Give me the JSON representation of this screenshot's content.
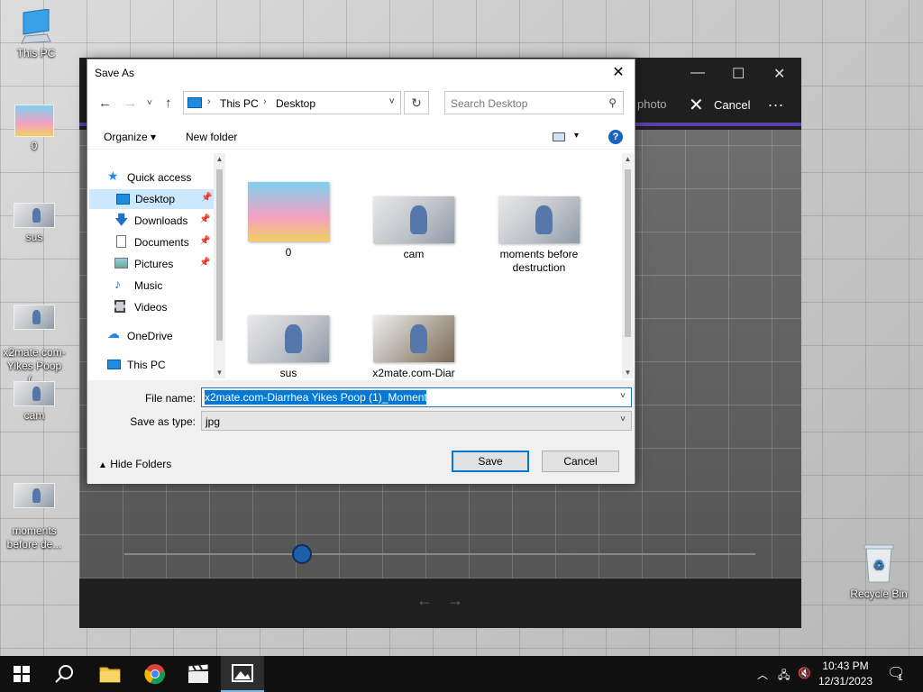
{
  "desktop": {
    "icons": [
      {
        "label": "This PC"
      },
      {
        "label": "0"
      },
      {
        "label": "sus"
      },
      {
        "label": "x2mate.com-\nYikes Poop (..."
      },
      {
        "label": "cam"
      },
      {
        "label": "moments\nbefore de..."
      },
      {
        "label": "Recycle Bin"
      }
    ]
  },
  "photo_app": {
    "save_photo_label": "photo",
    "cancel_label": "Cancel",
    "more_label": "..."
  },
  "dialog": {
    "title": "Save As",
    "address": {
      "segments": [
        "This PC",
        "Desktop"
      ]
    },
    "search": {
      "placeholder": "Search Desktop"
    },
    "toolbar": {
      "organize": "Organize",
      "new_folder": "New folder"
    },
    "nav": [
      {
        "label": "Quick access"
      },
      {
        "label": "Desktop"
      },
      {
        "label": "Downloads"
      },
      {
        "label": "Documents"
      },
      {
        "label": "Pictures"
      },
      {
        "label": "Music"
      },
      {
        "label": "Videos"
      },
      {
        "label": "OneDrive"
      },
      {
        "label": "This PC"
      }
    ],
    "files": [
      {
        "name": "0"
      },
      {
        "name": "cam"
      },
      {
        "name": "moments before destruction"
      },
      {
        "name": "sus"
      },
      {
        "name": "x2mate.com-Diar"
      }
    ],
    "file_name_label": "File name:",
    "file_name_value": "x2mate.com-Diarrhea Yikes Poop (1)_Moment",
    "save_type_label": "Save as type:",
    "save_type_value": "jpg",
    "hide_folders": "Hide Folders",
    "save_button": "Save",
    "cancel_button": "Cancel"
  },
  "taskbar": {
    "time": "10:43 PM",
    "date": "12/31/2023",
    "notification_count": "1"
  },
  "colors": {
    "accent": "#0078d7",
    "selection": "#cce8ff",
    "photo_app_accent": "#5b3fa8"
  }
}
